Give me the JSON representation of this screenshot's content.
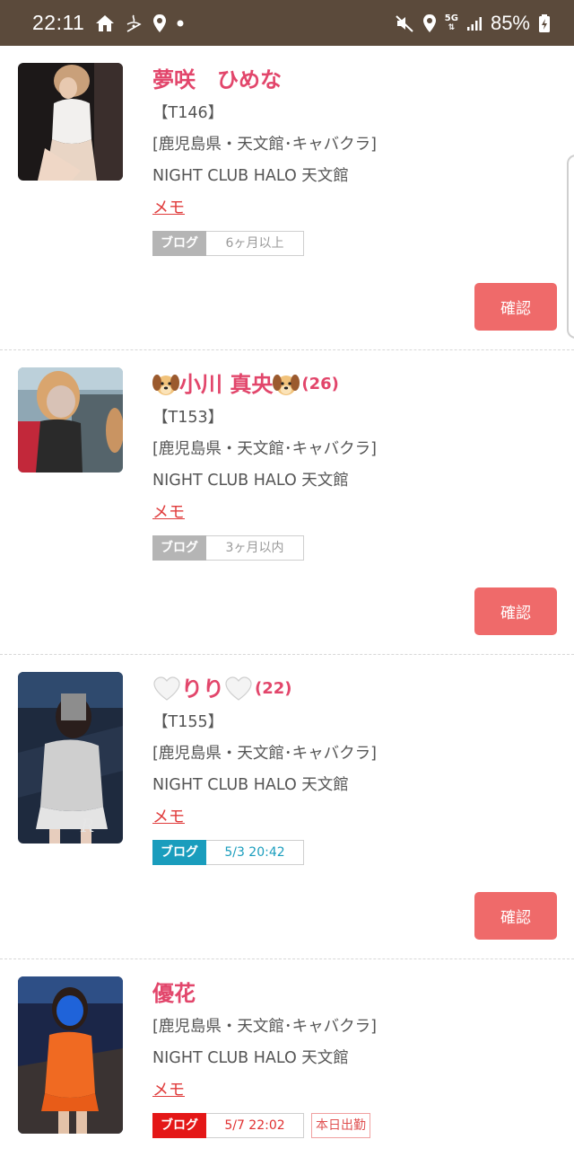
{
  "status_bar": {
    "time": "22:11",
    "battery": "85%",
    "network": "5G",
    "left_icons": [
      "home-icon",
      "notification-app-icon",
      "location-icon",
      "dot-icon"
    ],
    "right_icons": [
      "mute-icon",
      "location-icon",
      "5g-icon",
      "signal-icon",
      "battery-charging-icon"
    ]
  },
  "colors": {
    "status_bar": "#5b4a3b",
    "name": "#e2466b",
    "memo": "#e03c3c",
    "confirm_button": "#ef6a6a",
    "blog_gray": "#b5b5b5",
    "blog_blue": "#1a9dbd",
    "blog_red": "#e41717"
  },
  "entries": [
    {
      "name": "夢咲　ひめな",
      "code": "【T146】",
      "region": "[鹿児島県・天文館･キャバクラ]",
      "shop": "NIGHT CLUB HALO 天文館",
      "memo": "メモ",
      "blog_label": "ブログ",
      "blog_date": "6ヶ月以上",
      "confirm": "確認"
    },
    {
      "name_pre_icon": "dog-face-icon",
      "name": "小川 真央",
      "name_post_icon": "dog-face-icon",
      "age": "(26)",
      "code": "【T153】",
      "region": "[鹿児島県・天文館･キャバクラ]",
      "shop": "NIGHT CLUB HALO 天文館",
      "memo": "メモ",
      "blog_label": "ブログ",
      "blog_date": "3ヶ月以内",
      "confirm": "確認"
    },
    {
      "name_pre_icon": "white-heart-icon",
      "name": "りり",
      "name_post_icon": "white-heart-icon",
      "age": "(22)",
      "code": "【T155】",
      "region": "[鹿児島県・天文館･キャバクラ]",
      "shop": "NIGHT CLUB HALO 天文館",
      "memo": "メモ",
      "blog_label": "ブログ",
      "blog_date": "5/3 20:42",
      "confirm": "確認"
    },
    {
      "name": "優花",
      "region": "[鹿児島県・天文館･キャバクラ]",
      "shop": "NIGHT CLUB HALO 天文館",
      "memo": "メモ",
      "blog_label": "ブログ",
      "blog_date": "5/7 22:02",
      "work_badge": "本日出勤"
    }
  ]
}
